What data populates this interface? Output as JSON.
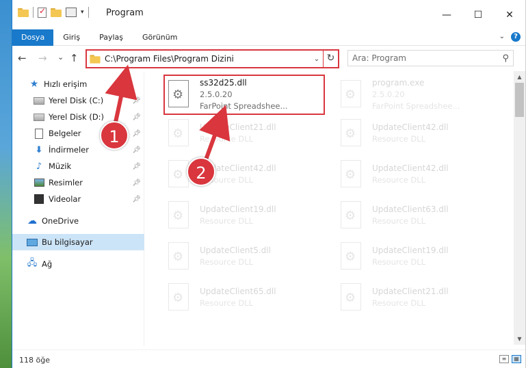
{
  "window": {
    "title": "Program"
  },
  "controls": {
    "minimize": "—",
    "maximize": "☐",
    "close": "✕"
  },
  "ribbon": {
    "tabs": [
      "Dosya",
      "Giriş",
      "Paylaş",
      "Görünüm"
    ],
    "help": "?"
  },
  "nav": {
    "back": "←",
    "forward": "→",
    "recent": "⌄",
    "up": "↑",
    "address": "C:\\Program Files\\Program Dizini",
    "search_placeholder": "Ara: Program"
  },
  "sidebar": {
    "items": [
      {
        "label": "Hızlı erişim",
        "icon": "star-icon"
      },
      {
        "label": "Yerel Disk (C:)",
        "icon": "disk-icon",
        "pinned": true
      },
      {
        "label": "Yerel Disk (D:)",
        "icon": "disk-icon",
        "pinned": true
      },
      {
        "label": "Belgeler",
        "icon": "document-icon",
        "pinned": true
      },
      {
        "label": "İndirmeler",
        "icon": "download-icon",
        "pinned": true
      },
      {
        "label": "Müzik",
        "icon": "music-icon",
        "pinned": true
      },
      {
        "label": "Resimler",
        "icon": "pictures-icon",
        "pinned": true
      },
      {
        "label": "Videolar",
        "icon": "videos-icon",
        "pinned": true
      },
      {
        "label": "OneDrive",
        "icon": "cloud-icon"
      },
      {
        "label": "Bu bilgisayar",
        "icon": "computer-icon",
        "selected": true
      },
      {
        "label": "Ağ",
        "icon": "network-icon"
      }
    ]
  },
  "files": [
    {
      "name": "ss32d25.dll",
      "line2": "2.5.0.20",
      "line3": "FarPoint Spreadshee...",
      "highlighted": true
    },
    {
      "name": "program.exe",
      "line2": "2.5.0.20",
      "line3": "FarPoint Spreadshee..."
    },
    {
      "name": "UpdateClient21.dll",
      "line2": "Resource DLL"
    },
    {
      "name": "UpdateClient42.dll",
      "line2": "Resource DLL"
    },
    {
      "name": "UpdateClient42.dll",
      "line2": "Resource DLL"
    },
    {
      "name": "UpdateClient42.dll",
      "line2": "Resource DLL"
    },
    {
      "name": "UpdateClient19.dll",
      "line2": "Resource DLL"
    },
    {
      "name": "UpdateClient63.dll",
      "line2": "Resource DLL"
    },
    {
      "name": "UpdateClient5.dll",
      "line2": "Resource DLL"
    },
    {
      "name": "UpdateClient19.dll",
      "line2": "Resource DLL"
    },
    {
      "name": "UpdateClient65.dll",
      "line2": "Resource DLL"
    },
    {
      "name": "UpdateClient21.dll",
      "line2": "Resource DLL"
    }
  ],
  "status": {
    "count": "118 öğe"
  },
  "annotations": {
    "step1": "1",
    "step2": "2",
    "color": "#d9363e"
  },
  "colors": {
    "accent": "#1979ca",
    "selection": "#cce4f7"
  }
}
